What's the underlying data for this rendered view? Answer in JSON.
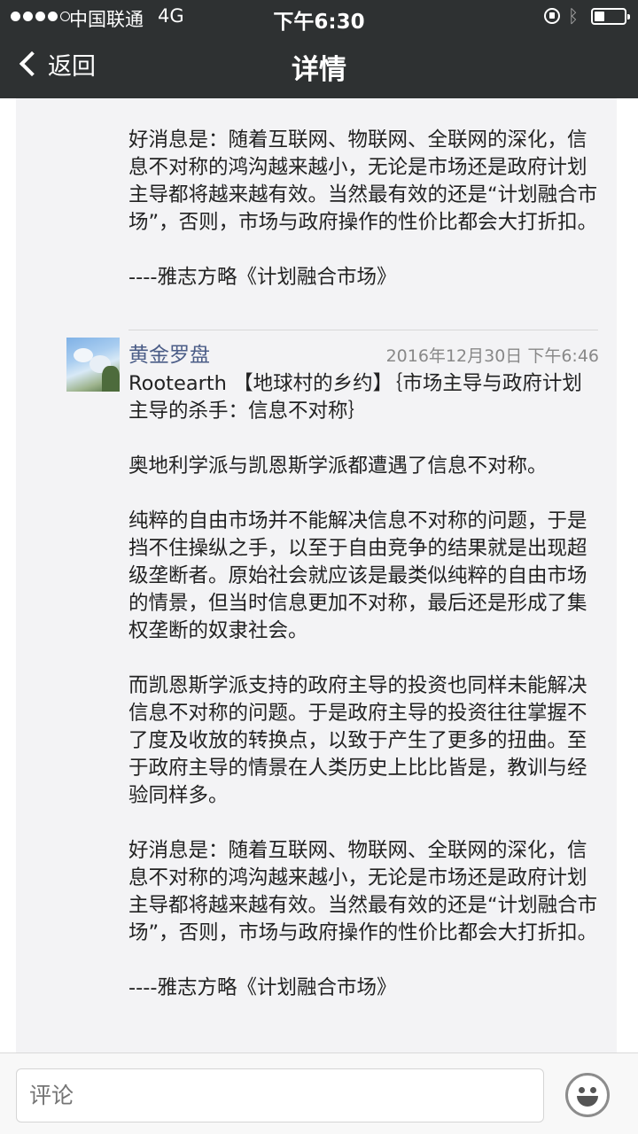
{
  "status_bar": {
    "carrier": "中国联通",
    "network": "4G",
    "time": "下午6:30"
  },
  "nav": {
    "back_label": "返回",
    "title": "详情"
  },
  "previous_comment": {
    "paragraphs": [
      "好消息是：随着互联网、物联网、全联网的深化，信息不对称的鸿沟越来越小，无论是市场还是政府计划主导都将越来越有效。当然最有效的还是“计划融合市场”，否则，市场与政府操作的性价比都会大打折扣。",
      "----雅志方略《计划融合市场》"
    ]
  },
  "comment": {
    "author": "黄金罗盘",
    "timestamp": "2016年12月30日 下午6:46",
    "paragraphs": [
      "Rootearth 【地球村的乡约】｛市场主导与政府计划主导的杀手：信息不对称｝",
      "奥地利学派与凯恩斯学派都遭遇了信息不对称。",
      "纯粹的自由市场并不能解决信息不对称的问题，于是挡不住操纵之手，以至于自由竞争的结果就是出现超级垄断者。原始社会就应该是最类似纯粹的自由市场的情景，但当时信息更加不对称，最后还是形成了集权垄断的奴隶社会。",
      "而凯恩斯学派支持的政府主导的投资也同样未能解决信息不对称的问题。于是政府主导的投资往往掌握不了度及收放的转换点，以致于产生了更多的扭曲。至于政府主导的情景在人类历史上比比皆是，教训与经验同样多。",
      "好消息是：随着互联网、物联网、全联网的深化，信息不对称的鸿沟越来越小，无论是市场还是政府计划主导都将越来越有效。当然最有效的还是“计划融合市场”，否则，市场与政府操作的性价比都会大打折扣。",
      "----雅志方略《计划融合市场》"
    ]
  },
  "input_bar": {
    "placeholder": "评论",
    "emoji_icon": "emoji-smile-icon"
  }
}
